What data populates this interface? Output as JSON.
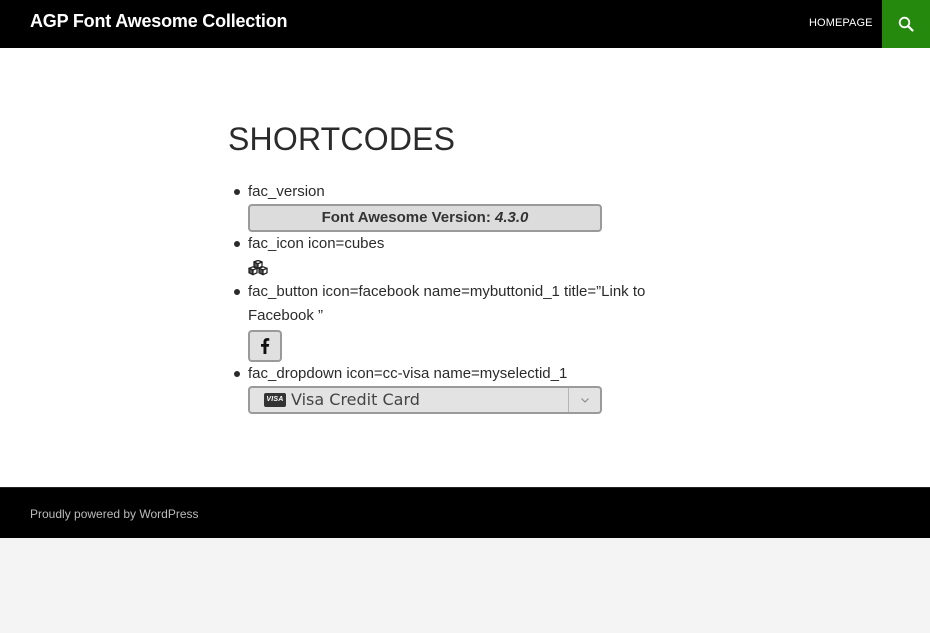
{
  "header": {
    "site_title": "AGP Font Awesome Collection",
    "nav": [
      {
        "label": "HOMEPAGE"
      }
    ],
    "search_icon": "search-icon"
  },
  "main": {
    "page_title": "SHORTCODES",
    "items": [
      {
        "label": "fac_version",
        "version_label": "Font Awesome Version:",
        "version_value": "4.3.0"
      },
      {
        "label": "fac_icon icon=cubes",
        "icon": "cubes-icon"
      },
      {
        "label": "fac_button icon=facebook name=mybuttonid_1 title=”Link to Facebook ”",
        "icon": "facebook-icon"
      },
      {
        "label": "fac_dropdown icon=cc-visa name=myselectid_1",
        "select_icon_text": "VISA",
        "select_value": "Visa Credit Card"
      }
    ]
  },
  "footer": {
    "credit": "Proudly powered by WordPress"
  },
  "colors": {
    "header_bg": "#000000",
    "search_bg": "#24890d",
    "content_bg": "#ffffff",
    "page_bg": "#f4f4f4"
  }
}
